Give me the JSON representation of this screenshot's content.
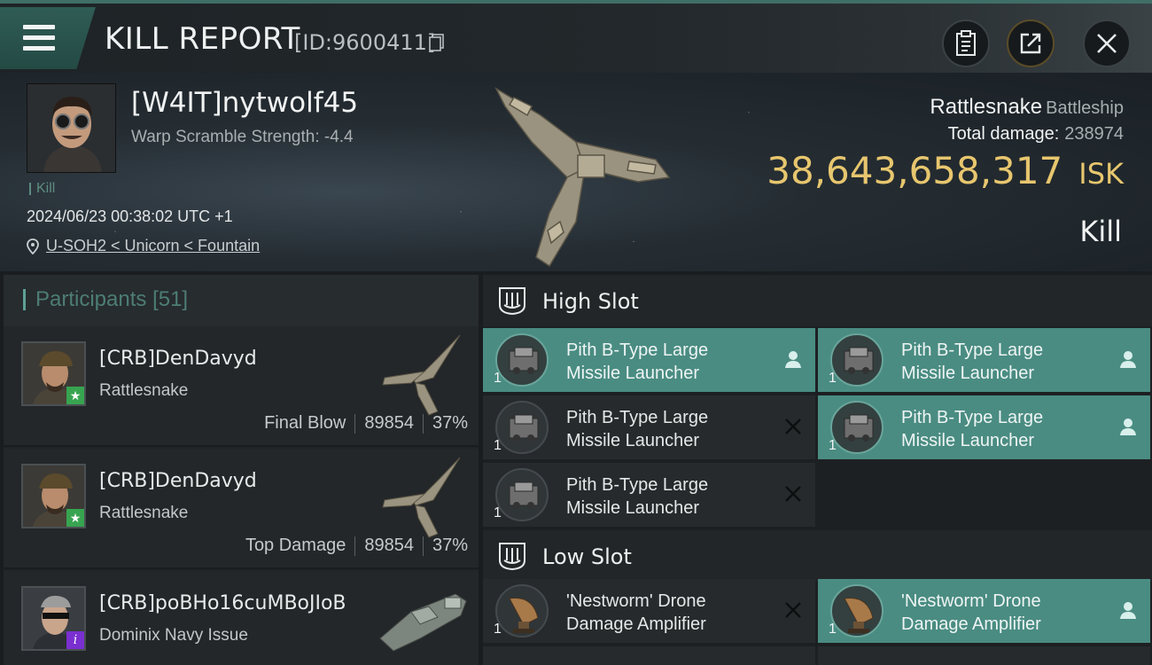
{
  "header": {
    "title": "KILL REPORT",
    "report_id": "[ID:9600411]"
  },
  "victim": {
    "name": "[W4IT]nytwolf45",
    "warp_scramble": "Warp Scramble Strength: -4.4",
    "tag": "Kill",
    "datetime": "2024/06/23 00:38:02 UTC +1",
    "location": "U-SOH2 < Unicorn < Fountain",
    "ship_name": "Rattlesnake",
    "ship_class": "Battleship",
    "total_damage_label": "Total damage:",
    "total_damage": "238974",
    "isk_value": "38,643,658,317",
    "isk_unit": "ISK",
    "result": "Kill"
  },
  "participants": {
    "title": "Participants",
    "count": "[51]",
    "items": [
      {
        "name": "[CRB]DenDavyd",
        "ship": "Rattlesnake",
        "label": "Final Blow",
        "damage": "89854",
        "percent": "37%",
        "badge": "★"
      },
      {
        "name": "[CRB]DenDavyd",
        "ship": "Rattlesnake",
        "label": "Top Damage",
        "damage": "89854",
        "percent": "37%",
        "badge": "★"
      },
      {
        "name": "[CRB]poBHo16cuMBoJIoB",
        "ship": "Dominix Navy Issue",
        "label": "",
        "damage": "",
        "percent": "",
        "badge": "i"
      }
    ]
  },
  "high_slot": {
    "title": "High Slot",
    "modules": [
      {
        "line1": "Pith B-Type Large",
        "line2": "Missile Launcher",
        "qty": "1",
        "status": "dropped"
      },
      {
        "line1": "Pith B-Type Large",
        "line2": "Missile Launcher",
        "qty": "1",
        "status": "dropped"
      },
      {
        "line1": "Pith B-Type Large",
        "line2": "Missile Launcher",
        "qty": "1",
        "status": "destroyed"
      },
      {
        "line1": "Pith B-Type Large",
        "line2": "Missile Launcher",
        "qty": "1",
        "status": "dropped"
      },
      {
        "line1": "Pith B-Type Large",
        "line2": "Missile Launcher",
        "qty": "1",
        "status": "destroyed"
      }
    ]
  },
  "low_slot": {
    "title": "Low Slot",
    "modules": [
      {
        "line1": "'Nestworm' Drone",
        "line2": "Damage Amplifier",
        "qty": "1",
        "status": "destroyed"
      },
      {
        "line1": "'Nestworm' Drone",
        "line2": "Damage Amplifier",
        "qty": "1",
        "status": "dropped"
      }
    ]
  },
  "colors": {
    "accent_teal": "#4a8c82",
    "isk_gold": "#e7c66e",
    "badge_green": "#37a450",
    "badge_purple": "#7a2fd0"
  },
  "icons": [
    "menu-icon",
    "copy-icon",
    "clipboard-icon",
    "share-icon",
    "close-icon",
    "location-pin-icon",
    "slot-icon",
    "person-icon",
    "x-icon"
  ]
}
